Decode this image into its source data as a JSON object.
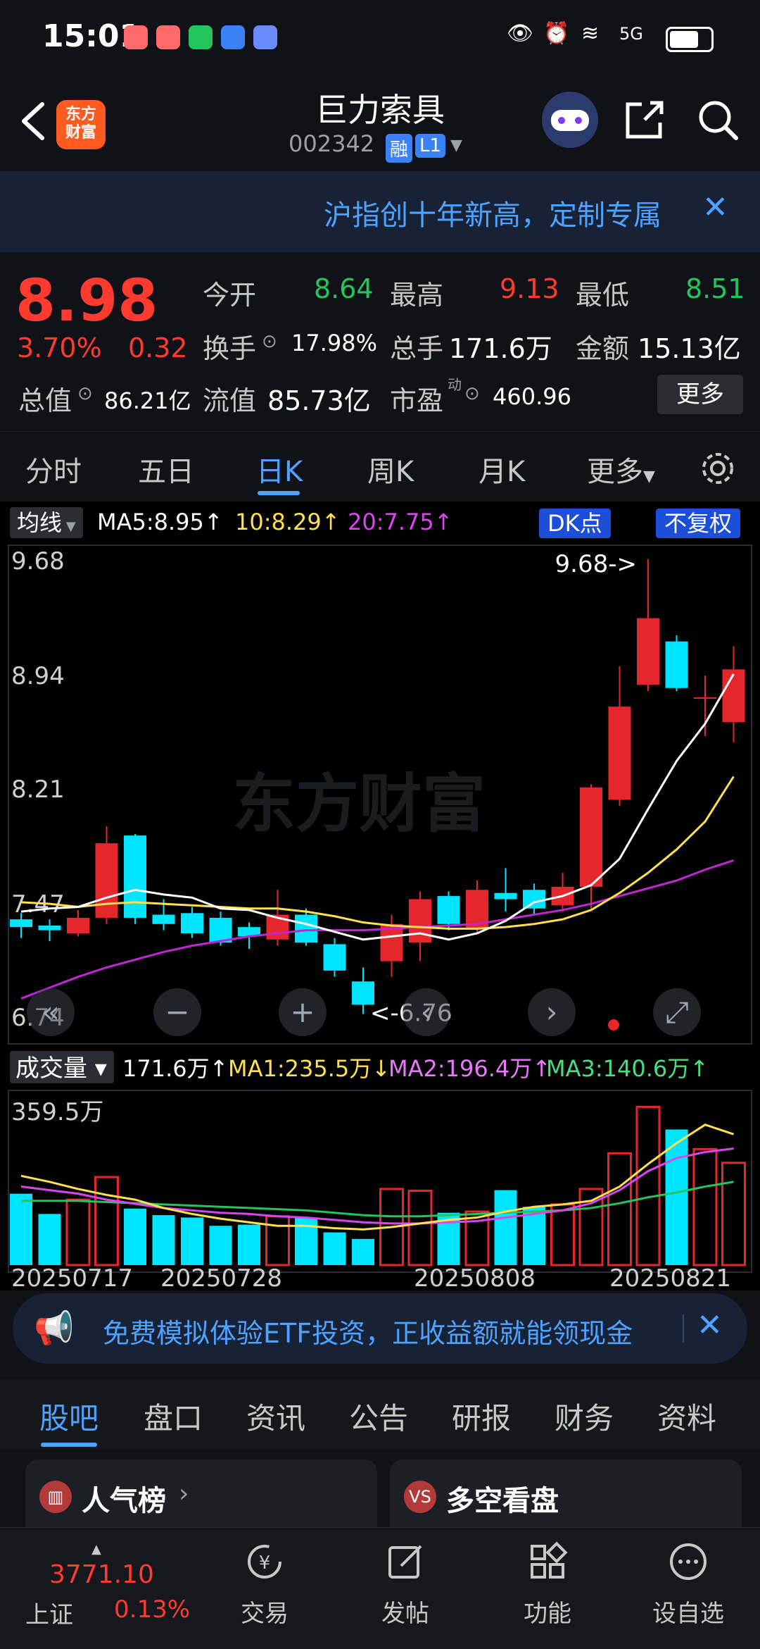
{
  "status_bar": {
    "time": "15:01",
    "network": "5G"
  },
  "header": {
    "logo_text": "东方\n财富",
    "stock_name": "巨力索具",
    "stock_code": "002342",
    "tag_rong": "融",
    "tag_l1": "L1"
  },
  "banner": {
    "text": "沪指创十年新高，定制专属"
  },
  "quote": {
    "price": "8.98",
    "change_pct": "3.70%",
    "change_abs": "0.32",
    "open_label": "今开",
    "open_value": "8.64",
    "high_label": "最高",
    "high_value": "9.13",
    "low_label": "最低",
    "low_value": "8.51",
    "turnover_label": "换手",
    "turnover_value": "17.98%",
    "volume_label": "总手",
    "volume_value": "171.6万",
    "amount_label": "金额",
    "amount_value": "15.13亿",
    "mktcap_label": "总值",
    "mktcap_value": "86.21亿",
    "float_label": "流值",
    "float_value": "85.73亿",
    "pe_label": "市盈",
    "pe_sup": "动",
    "pe_value": "460.96",
    "more_label": "更多"
  },
  "tabs": [
    "分时",
    "五日",
    "日K",
    "周K",
    "月K",
    "更多"
  ],
  "active_tab": "日K",
  "ma_line": {
    "selector": "均线",
    "ma5": "MA5:8.95↑",
    "ma10": "10:8.29↑",
    "ma20": "20:7.75↑",
    "dk_label": "DK点",
    "fq_label": "不复权"
  },
  "volume_line": {
    "selector": "成交量",
    "vol": "171.6万↑",
    "ma1": "MA1:235.5万↓",
    "ma2": "MA2:196.4万↑",
    "ma3": "MA3:140.6万↑"
  },
  "chart_data": {
    "type": "candlestick",
    "y_ticks": [
      "9.68",
      "8.94",
      "8.21",
      "7.47",
      "6.74"
    ],
    "ylim": [
      6.74,
      9.68
    ],
    "max_annotation": "9.68->",
    "min_annotation": "<-6.76",
    "watermark": "东方财富",
    "candles": [
      {
        "o": 7.37,
        "h": 7.41,
        "l": 7.25,
        "c": 7.32
      },
      {
        "o": 7.33,
        "h": 7.37,
        "l": 7.23,
        "c": 7.3
      },
      {
        "o": 7.28,
        "h": 7.43,
        "l": 7.26,
        "c": 7.38
      },
      {
        "o": 7.38,
        "h": 7.97,
        "l": 7.34,
        "c": 7.86
      },
      {
        "o": 7.91,
        "h": 7.92,
        "l": 7.34,
        "c": 7.38
      },
      {
        "o": 7.4,
        "h": 7.5,
        "l": 7.3,
        "c": 7.34
      },
      {
        "o": 7.41,
        "h": 7.45,
        "l": 7.25,
        "c": 7.28
      },
      {
        "o": 7.38,
        "h": 7.42,
        "l": 7.2,
        "c": 7.22
      },
      {
        "o": 7.32,
        "h": 7.35,
        "l": 7.18,
        "c": 7.26
      },
      {
        "o": 7.24,
        "h": 7.56,
        "l": 7.2,
        "c": 7.4
      },
      {
        "o": 7.4,
        "h": 7.44,
        "l": 7.2,
        "c": 7.22
      },
      {
        "o": 7.21,
        "h": 7.25,
        "l": 7.0,
        "c": 7.04
      },
      {
        "o": 6.97,
        "h": 7.06,
        "l": 6.76,
        "c": 6.82
      },
      {
        "o": 7.1,
        "h": 7.4,
        "l": 7.0,
        "c": 7.34
      },
      {
        "o": 7.22,
        "h": 7.55,
        "l": 7.1,
        "c": 7.5
      },
      {
        "o": 7.52,
        "h": 7.55,
        "l": 7.3,
        "c": 7.34
      },
      {
        "o": 7.31,
        "h": 7.62,
        "l": 7.28,
        "c": 7.56
      },
      {
        "o": 7.54,
        "h": 7.7,
        "l": 7.42,
        "c": 7.5
      },
      {
        "o": 7.56,
        "h": 7.6,
        "l": 7.4,
        "c": 7.44
      },
      {
        "o": 7.46,
        "h": 7.67,
        "l": 7.42,
        "c": 7.58
      },
      {
        "o": 7.58,
        "h": 8.24,
        "l": 7.44,
        "c": 8.22
      },
      {
        "o": 8.14,
        "h": 9.0,
        "l": 8.1,
        "c": 8.74
      },
      {
        "o": 8.88,
        "h": 9.69,
        "l": 8.84,
        "c": 9.31
      },
      {
        "o": 9.16,
        "h": 9.2,
        "l": 8.84,
        "c": 8.86
      },
      {
        "o": 8.8,
        "h": 8.94,
        "l": 8.55,
        "c": 8.8
      },
      {
        "o": 8.64,
        "h": 9.13,
        "l": 8.51,
        "c": 8.98
      }
    ],
    "ma5": [
      7.42,
      7.44,
      7.45,
      7.51,
      7.56,
      7.53,
      7.51,
      7.44,
      7.43,
      7.38,
      7.34,
      7.29,
      7.24,
      7.26,
      7.28,
      7.24,
      7.28,
      7.36,
      7.48,
      7.52,
      7.59,
      7.76,
      8.08,
      8.39,
      8.63,
      8.95
    ],
    "ma10": [
      7.48,
      7.47,
      7.45,
      7.47,
      7.48,
      7.47,
      7.46,
      7.45,
      7.44,
      7.44,
      7.42,
      7.39,
      7.35,
      7.33,
      7.32,
      7.31,
      7.31,
      7.32,
      7.34,
      7.37,
      7.43,
      7.54,
      7.67,
      7.82,
      8.0,
      8.29
    ],
    "ma20": [
      6.86,
      6.93,
      7.0,
      7.06,
      7.11,
      7.16,
      7.2,
      7.23,
      7.26,
      7.28,
      7.3,
      7.3,
      7.3,
      7.31,
      7.32,
      7.33,
      7.34,
      7.37,
      7.4,
      7.43,
      7.47,
      7.52,
      7.57,
      7.62,
      7.69,
      7.75
    ],
    "volume_max_label": "359.5万",
    "volume": [
      120,
      86,
      110,
      148,
      95,
      84,
      80,
      66,
      68,
      82,
      80,
      55,
      44,
      128,
      125,
      88,
      90,
      126,
      98,
      102,
      128,
      188,
      266,
      228,
      195,
      172
    ],
    "vol_ma1": [
      150,
      140,
      128,
      118,
      110,
      96,
      86,
      78,
      72,
      66,
      66,
      62,
      60,
      64,
      70,
      76,
      80,
      90,
      98,
      102,
      108,
      132,
      170,
      205,
      236,
      220
    ],
    "vol_ma2": [
      132,
      126,
      120,
      110,
      103,
      96,
      92,
      88,
      86,
      82,
      80,
      76,
      72,
      70,
      70,
      72,
      74,
      80,
      86,
      92,
      104,
      126,
      158,
      180,
      190,
      196
    ],
    "vol_ma3": [
      108,
      108,
      108,
      106,
      104,
      102,
      100,
      98,
      96,
      94,
      92,
      88,
      84,
      82,
      82,
      84,
      86,
      88,
      90,
      92,
      96,
      104,
      114,
      122,
      132,
      140
    ],
    "x_labels": [
      "20250717",
      "20250728",
      "20250808",
      "20250821"
    ]
  },
  "ad": {
    "text": "免费模拟体验ETF投资，正收益额就能领现金"
  },
  "section_tabs": [
    "股吧",
    "盘口",
    "资讯",
    "公告",
    "研报",
    "财务",
    "资料"
  ],
  "cards": [
    {
      "title": "人气榜"
    },
    {
      "title": "多空看盘"
    }
  ],
  "bottom_nav": {
    "index_value": "3771.10",
    "index_name": "上证",
    "index_change": "0.13%",
    "items": [
      "交易",
      "发帖",
      "功能",
      "设自选"
    ]
  }
}
